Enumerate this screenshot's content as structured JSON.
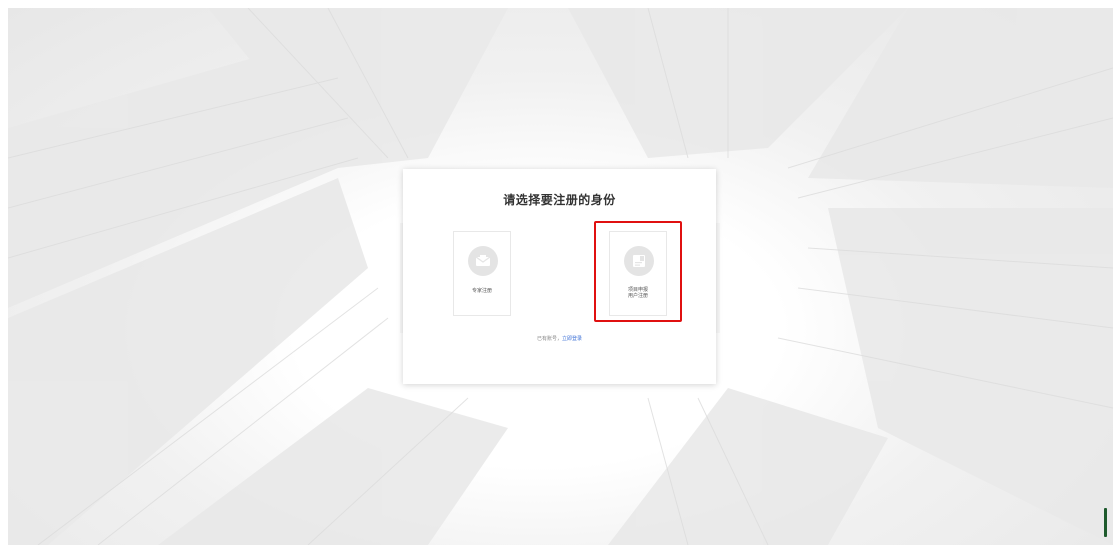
{
  "modal": {
    "title": "请选择要注册的身份"
  },
  "cards": {
    "expert": {
      "label": "专家注册",
      "icon": "envelope-icon"
    },
    "project": {
      "label_line1": "项目申报",
      "label_line2": "用户注册",
      "icon": "document-icon"
    }
  },
  "login": {
    "prompt": "已有账号，",
    "link": "立即登录"
  },
  "colors": {
    "highlight": "#e01010",
    "link": "#3b6fd6",
    "scroll_thumb": "#1d5a2c"
  }
}
